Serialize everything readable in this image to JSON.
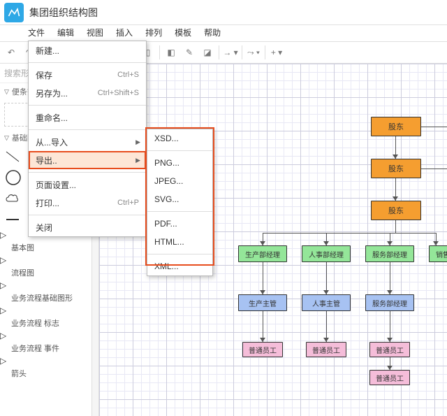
{
  "title": "集团组织结构图",
  "menubar": [
    "文件",
    "编辑",
    "视图",
    "插入",
    "排列",
    "模板",
    "帮助"
  ],
  "search_placeholder": "搜索形",
  "scratchpad": "便条簿",
  "shapes_section": "基础图",
  "palette": [
    "基本图",
    "流程图",
    "业务流程基础图形",
    "业务流程 标志",
    "业务流程 事件",
    "箭头"
  ],
  "file_menu": {
    "new": "新建...",
    "save": "保存",
    "saveas": "另存为...",
    "rename": "重命名...",
    "import": "从...导入",
    "export": "导出..",
    "pagesetup": "页面设置...",
    "print": "打印...",
    "close": "关闭",
    "sc_save": "Ctrl+S",
    "sc_saveas": "Ctrl+Shift+S",
    "sc_print": "Ctrl+P"
  },
  "export_menu": [
    "XSD...",
    "PNG...",
    "JPEG...",
    "SVG...",
    "PDF...",
    "HTML...",
    "XML..."
  ],
  "org": {
    "levels": [
      "股东",
      "股东",
      "股东"
    ],
    "managers": [
      "生产部经理",
      "人事部经理",
      "服务部经理",
      "销售"
    ],
    "supervisors": [
      "生产主管",
      "人事主管",
      "服务部经理"
    ],
    "staff": [
      "普通员工",
      "普通员工",
      "普通员工",
      "普通员工"
    ]
  }
}
